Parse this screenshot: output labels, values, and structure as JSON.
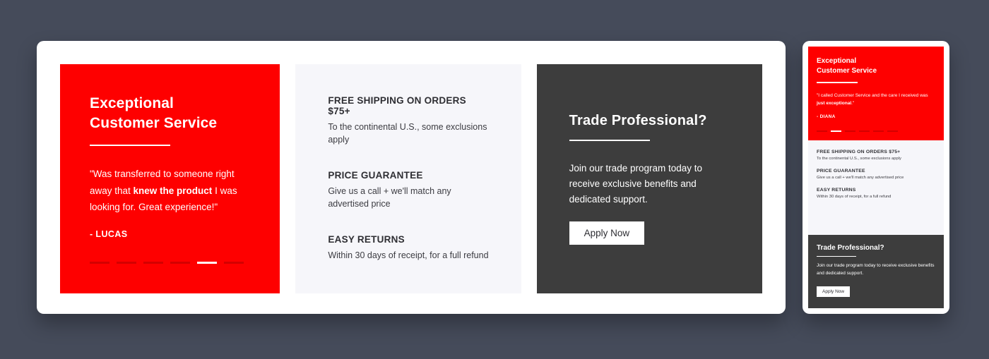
{
  "colors": {
    "page_background": "#454b5a",
    "brand_red": "#fe0000",
    "panel_light": "#f6f6fa",
    "panel_dark": "#3d3d3d",
    "card_white": "#ffffff"
  },
  "desktop": {
    "testimonial": {
      "title_line1": "Exceptional",
      "title_line2": "Customer Service",
      "quote_before": "\"Was transferred to someone right away that ",
      "quote_emphasis": "knew the product",
      "quote_after": " I was looking for. Great experience!\"",
      "author": "- LUCAS",
      "carousel": {
        "total_dots": 6,
        "active_index": 5
      }
    },
    "benefits": [
      {
        "title": "FREE SHIPPING ON ORDERS $75+",
        "subtitle": "To the continental U.S., some exclusions apply"
      },
      {
        "title": "PRICE GUARANTEE",
        "subtitle": "Give us a call + we'll match any advertised price"
      },
      {
        "title": "EASY RETURNS",
        "subtitle": "Within 30 days of receipt, for a full refund"
      }
    ],
    "trade": {
      "title": "Trade Professional?",
      "description": "Join our trade program today to receive exclusive benefits and dedicated support.",
      "button_label": "Apply Now"
    }
  },
  "mobile": {
    "testimonial": {
      "title_line1": "Exceptional",
      "title_line2": "Customer Service",
      "quote_before": "\"I called Customer Service and the care I received was ",
      "quote_emphasis": "just exceptional",
      "quote_after": ".\"",
      "author": "- DIANA",
      "carousel": {
        "total_dots": 6,
        "active_index": 2
      }
    },
    "benefits": [
      {
        "title": "FREE SHIPPING ON ORDERS $75+",
        "subtitle": "To the continental U.S., some exclusions apply"
      },
      {
        "title": "PRICE GUARANTEE",
        "subtitle": "Give us a call + we'll match any advertised price"
      },
      {
        "title": "EASY RETURNS",
        "subtitle": "Within 30 days of receipt, for a full refund"
      }
    ],
    "trade": {
      "title": "Trade Professional?",
      "description": "Join our trade program today to receive exclusive benefits and dedicated support.",
      "button_label": "Apply Now"
    }
  }
}
